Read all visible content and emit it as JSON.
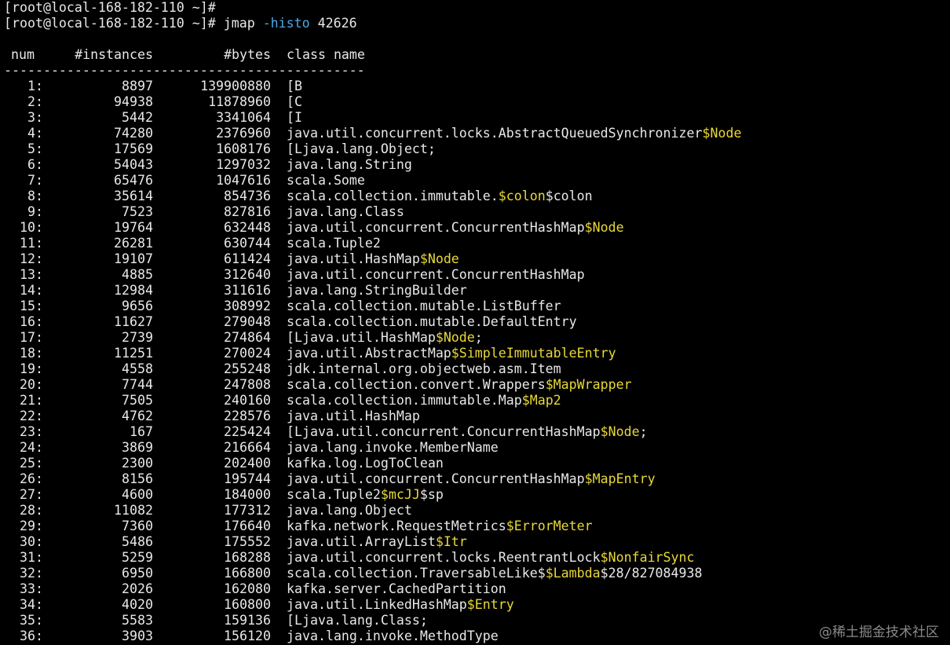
{
  "prompt": {
    "line1": "[root@local-168-182-110 ~]#",
    "line2_prompt": "[root@local-168-182-110 ~]# ",
    "line2_cmd": "jmap ",
    "line2_flag": "-histo",
    "line2_arg": " 42626"
  },
  "table": {
    "headers": {
      "num": "num",
      "instances": "#instances",
      "bytes": "#bytes",
      "class_name": "class name"
    },
    "separator": "----------------------------------------------",
    "rows": [
      {
        "num": "1:",
        "instances": "8897",
        "bytes": "139900880",
        "name": "[B",
        "suffix": ""
      },
      {
        "num": "2:",
        "instances": "94938",
        "bytes": "11878960",
        "name": "[C",
        "suffix": ""
      },
      {
        "num": "3:",
        "instances": "5442",
        "bytes": "3341064",
        "name": "[I",
        "suffix": ""
      },
      {
        "num": "4:",
        "instances": "74280",
        "bytes": "2376960",
        "name": "java.util.concurrent.locks.AbstractQueuedSynchronizer",
        "suffix": "$Node"
      },
      {
        "num": "5:",
        "instances": "17569",
        "bytes": "1608176",
        "name": "[Ljava.lang.Object;",
        "suffix": ""
      },
      {
        "num": "6:",
        "instances": "54043",
        "bytes": "1297032",
        "name": "java.lang.String",
        "suffix": ""
      },
      {
        "num": "7:",
        "instances": "65476",
        "bytes": "1047616",
        "name": "scala.Some",
        "suffix": ""
      },
      {
        "num": "8:",
        "instances": "35614",
        "bytes": "854736",
        "name": "scala.collection.immutable.",
        "suffix": "$colon",
        "tail": "$colon"
      },
      {
        "num": "9:",
        "instances": "7523",
        "bytes": "827816",
        "name": "java.lang.Class",
        "suffix": ""
      },
      {
        "num": "10:",
        "instances": "19764",
        "bytes": "632448",
        "name": "java.util.concurrent.ConcurrentHashMap",
        "suffix": "$Node"
      },
      {
        "num": "11:",
        "instances": "26281",
        "bytes": "630744",
        "name": "scala.Tuple2",
        "suffix": ""
      },
      {
        "num": "12:",
        "instances": "19107",
        "bytes": "611424",
        "name": "java.util.HashMap",
        "suffix": "$Node"
      },
      {
        "num": "13:",
        "instances": "4885",
        "bytes": "312640",
        "name": "java.util.concurrent.ConcurrentHashMap",
        "suffix": ""
      },
      {
        "num": "14:",
        "instances": "12984",
        "bytes": "311616",
        "name": "java.lang.StringBuilder",
        "suffix": ""
      },
      {
        "num": "15:",
        "instances": "9656",
        "bytes": "308992",
        "name": "scala.collection.mutable.ListBuffer",
        "suffix": ""
      },
      {
        "num": "16:",
        "instances": "11627",
        "bytes": "279048",
        "name": "scala.collection.mutable.DefaultEntry",
        "suffix": ""
      },
      {
        "num": "17:",
        "instances": "2739",
        "bytes": "274864",
        "name": "[Ljava.util.HashMap",
        "suffix": "$Node",
        "tail": ";"
      },
      {
        "num": "18:",
        "instances": "11251",
        "bytes": "270024",
        "name": "java.util.AbstractMap",
        "suffix": "$SimpleImmutableEntry"
      },
      {
        "num": "19:",
        "instances": "4558",
        "bytes": "255248",
        "name": "jdk.internal.org.objectweb.asm.Item",
        "suffix": ""
      },
      {
        "num": "20:",
        "instances": "7744",
        "bytes": "247808",
        "name": "scala.collection.convert.Wrappers",
        "suffix": "$MapWrapper"
      },
      {
        "num": "21:",
        "instances": "7505",
        "bytes": "240160",
        "name": "scala.collection.immutable.Map",
        "suffix": "$Map2"
      },
      {
        "num": "22:",
        "instances": "4762",
        "bytes": "228576",
        "name": "java.util.HashMap",
        "suffix": ""
      },
      {
        "num": "23:",
        "instances": "167",
        "bytes": "225424",
        "name": "[Ljava.util.concurrent.ConcurrentHashMap",
        "suffix": "$Node",
        "tail": ";"
      },
      {
        "num": "24:",
        "instances": "3869",
        "bytes": "216664",
        "name": "java.lang.invoke.MemberName",
        "suffix": ""
      },
      {
        "num": "25:",
        "instances": "2300",
        "bytes": "202400",
        "name": "kafka.log.LogToClean",
        "suffix": ""
      },
      {
        "num": "26:",
        "instances": "8156",
        "bytes": "195744",
        "name": "java.util.concurrent.ConcurrentHashMap",
        "suffix": "$MapEntry"
      },
      {
        "num": "27:",
        "instances": "4600",
        "bytes": "184000",
        "name": "scala.Tuple2",
        "suffix": "$mcJJ",
        "tail": "$sp"
      },
      {
        "num": "28:",
        "instances": "11082",
        "bytes": "177312",
        "name": "java.lang.Object",
        "suffix": ""
      },
      {
        "num": "29:",
        "instances": "7360",
        "bytes": "176640",
        "name": "kafka.network.RequestMetrics",
        "suffix": "$ErrorMeter"
      },
      {
        "num": "30:",
        "instances": "5486",
        "bytes": "175552",
        "name": "java.util.ArrayList",
        "suffix": "$Itr"
      },
      {
        "num": "31:",
        "instances": "5259",
        "bytes": "168288",
        "name": "java.util.concurrent.locks.ReentrantLock",
        "suffix": "$NonfairSync"
      },
      {
        "num": "32:",
        "instances": "6950",
        "bytes": "166800",
        "name": "scala.collection.TraversableLike$",
        "suffix": "$Lambda",
        "tail": "$28/827084938"
      },
      {
        "num": "33:",
        "instances": "2026",
        "bytes": "162080",
        "name": "kafka.server.CachedPartition",
        "suffix": ""
      },
      {
        "num": "34:",
        "instances": "4020",
        "bytes": "160800",
        "name": "java.util.LinkedHashMap",
        "suffix": "$Entry"
      },
      {
        "num": "35:",
        "instances": "5583",
        "bytes": "159136",
        "name": "[Ljava.lang.Class;",
        "suffix": ""
      },
      {
        "num": "36:",
        "instances": "3903",
        "bytes": "156120",
        "name": "java.lang.invoke.MethodType",
        "suffix": ""
      }
    ]
  },
  "watermark": "@稀土掘金技术社区",
  "colors": {
    "background": "#000000",
    "text": "#e8e8e8",
    "flag": "#4aa8e8",
    "highlight": "#e8d838"
  }
}
